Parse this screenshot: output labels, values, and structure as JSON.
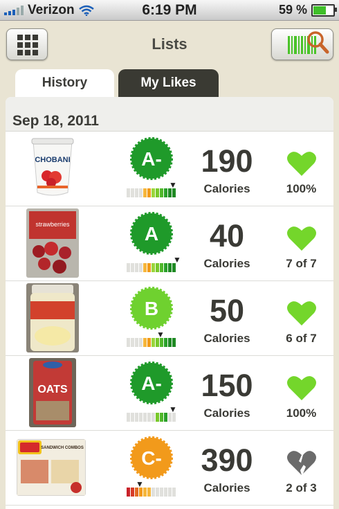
{
  "status_bar": {
    "carrier": "Verizon",
    "time": "6:19 PM",
    "battery": "59 %"
  },
  "nav": {
    "title": "Lists"
  },
  "tabs": [
    {
      "label": "History"
    },
    {
      "label": "My Likes"
    }
  ],
  "list": {
    "date": "Sep 18, 2011",
    "items": [
      {
        "grade": "A-",
        "calories": "190",
        "cal_label": "Calories",
        "likes": "100%",
        "liked": true,
        "product_text": "CHOBANI"
      },
      {
        "grade": "A",
        "calories": "40",
        "cal_label": "Calories",
        "likes": "7 of 7",
        "liked": true,
        "product_text": "strawberries"
      },
      {
        "grade": "B",
        "calories": "50",
        "cal_label": "Calories",
        "likes": "6 of 7",
        "liked": true,
        "product_text": ""
      },
      {
        "grade": "A-",
        "calories": "150",
        "cal_label": "Calories",
        "likes": "100%",
        "liked": true,
        "product_text": "OATS"
      },
      {
        "grade": "C-",
        "calories": "390",
        "cal_label": "Calories",
        "likes": "2 of 3",
        "liked": false,
        "product_text": "SANDWICH COMBOS"
      }
    ]
  },
  "colors": {
    "grade_dark_green": "#1f9a2a",
    "grade_light_green": "#6fd12f",
    "grade_orange": "#f29a1b",
    "heart_green": "#74d62b",
    "heart_gray": "#6b6b6b",
    "tab_dark": "#3a3a33",
    "background": "#e9e4d3"
  }
}
